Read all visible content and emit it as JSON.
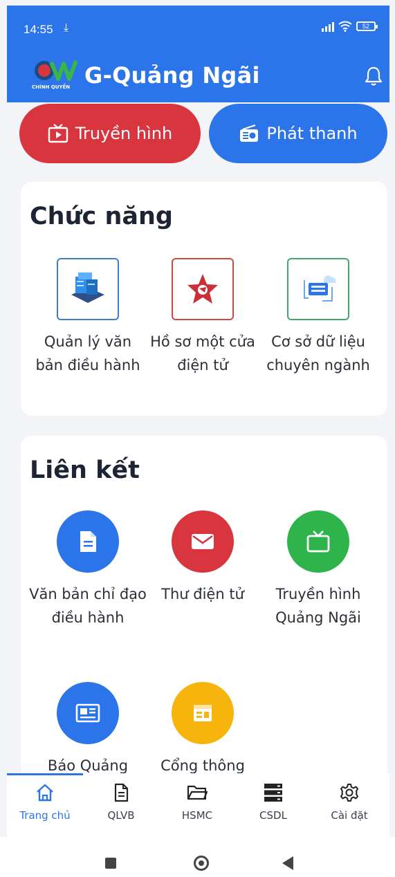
{
  "status": {
    "time": "14:55",
    "battery": "52"
  },
  "header": {
    "title": "G-Quảng Ngãi",
    "logo_text": "CHÍNH QUYỀN"
  },
  "pills": {
    "tv": "Truyền hình",
    "radio": "Phát thanh"
  },
  "functions": {
    "title": "Chức năng",
    "items": [
      {
        "label": "Quản lý văn bản điều hành",
        "icon": "servers-icon"
      },
      {
        "label": "Hồ sơ một cửa điện tử",
        "icon": "star-emblem-icon"
      },
      {
        "label": "Cơ sở dữ liệu chuyên ngành",
        "icon": "cloud-database-icon"
      }
    ]
  },
  "links": {
    "title": "Liên kết",
    "items": [
      {
        "label": "Văn bản chỉ đạo điều hành",
        "color": "#2b74ea",
        "icon": "document-icon"
      },
      {
        "label": "Thư điện tử",
        "color": "#d9353f",
        "icon": "mail-icon"
      },
      {
        "label": "Truyền hình Quảng Ngãi",
        "color": "#2fb44c",
        "icon": "tv-icon"
      },
      {
        "label": "Báo Quảng",
        "color": "#2b74ea",
        "icon": "newspaper-icon"
      },
      {
        "label": "Cổng thông",
        "color": "#f6b40c",
        "icon": "portal-icon"
      }
    ]
  },
  "nav": {
    "items": [
      {
        "label": "Trang chủ",
        "icon": "home-icon"
      },
      {
        "label": "QLVB",
        "icon": "document-icon"
      },
      {
        "label": "HSMC",
        "icon": "folder-icon"
      },
      {
        "label": "CSDL",
        "icon": "database-icon"
      },
      {
        "label": "Cài đặt",
        "icon": "gear-icon"
      }
    ],
    "active_index": 0
  },
  "colors": {
    "primary": "#2b74ea",
    "red": "#d9353f",
    "green": "#2fb44c",
    "yellow": "#f6b40c"
  }
}
